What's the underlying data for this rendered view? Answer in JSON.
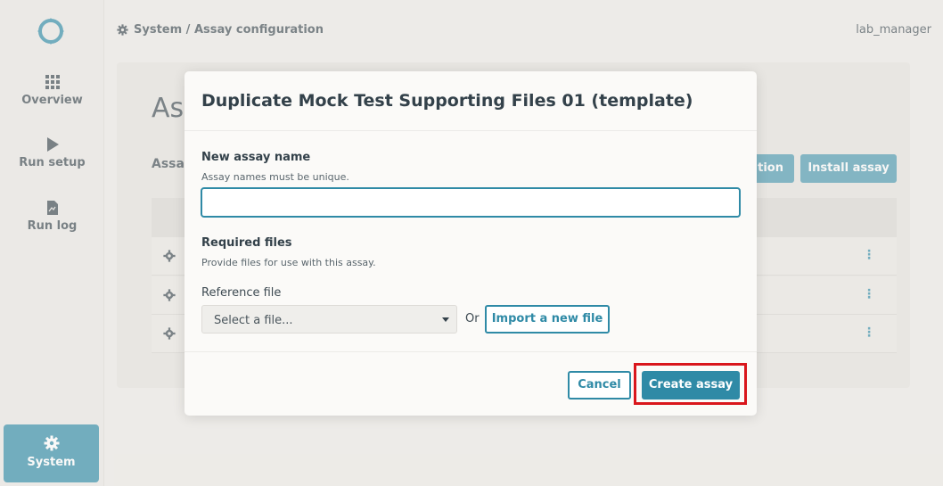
{
  "sidebar": {
    "items": [
      {
        "label": "Overview",
        "icon": "grid-icon"
      },
      {
        "label": "Run setup",
        "icon": "play-icon"
      },
      {
        "label": "Run log",
        "icon": "document-icon"
      }
    ],
    "system": {
      "label": "System",
      "icon": "gear-icon"
    }
  },
  "header": {
    "breadcrumb": "System / Assay configuration",
    "user": "lab_manager"
  },
  "background": {
    "page_title": "Ass",
    "section_title": "Assa",
    "partial_button": "tion",
    "install_button": "Install assay"
  },
  "modal": {
    "title": "Duplicate Mock Test Supporting Files 01 (template)",
    "name_label": "New assay name",
    "name_help": "Assay names must be unique.",
    "name_value": "",
    "required_label": "Required files",
    "required_help": "Provide files for use with this assay.",
    "reference_label": "Reference file",
    "select_placeholder": "Select a file...",
    "or_text": "Or",
    "import_button": "Import a new file",
    "cancel_button": "Cancel",
    "create_button": "Create assay"
  },
  "colors": {
    "accent": "#2f8aa6",
    "highlight": "#d9161c"
  }
}
